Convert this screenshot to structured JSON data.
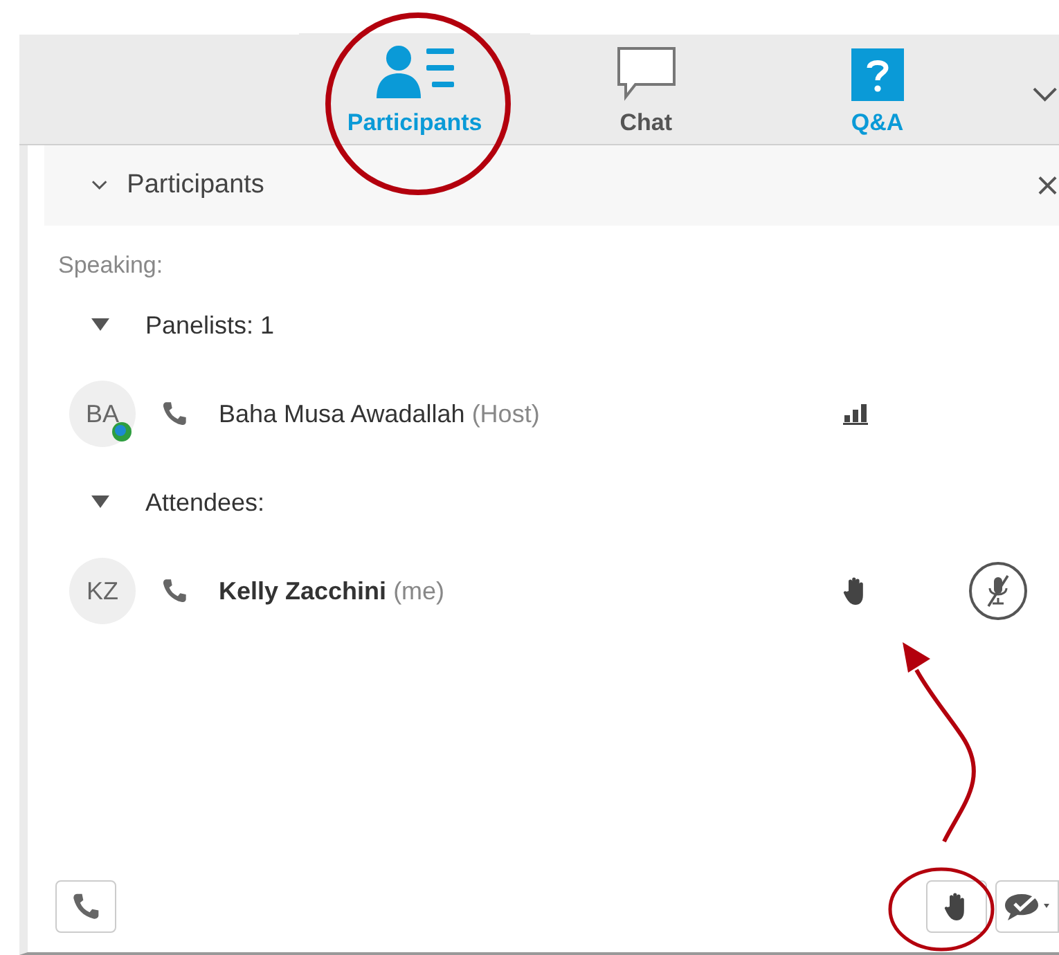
{
  "tabs": [
    {
      "kind": "participants",
      "label": "Participants",
      "selected": true
    },
    {
      "kind": "chat",
      "label": "Chat",
      "selected": false
    },
    {
      "kind": "qa",
      "label": "Q&A",
      "selected": false
    }
  ],
  "panel": {
    "title": "Participants",
    "speaking_label": "Speaking:"
  },
  "groups": [
    {
      "label": "Panelists: 1",
      "expanded": true,
      "members": [
        {
          "initials": "BA",
          "name": "Baha Musa Awadallah",
          "role": "(Host)",
          "is_me": false,
          "status_badge": true,
          "hand_raised": false,
          "audio_meter": true,
          "muted": false
        }
      ]
    },
    {
      "label": "Attendees:",
      "expanded": true,
      "members": [
        {
          "initials": "KZ",
          "name": "Kelly Zacchini",
          "role": "(me)",
          "is_me": true,
          "status_badge": false,
          "hand_raised": true,
          "audio_meter": false,
          "muted": true
        }
      ]
    }
  ]
}
